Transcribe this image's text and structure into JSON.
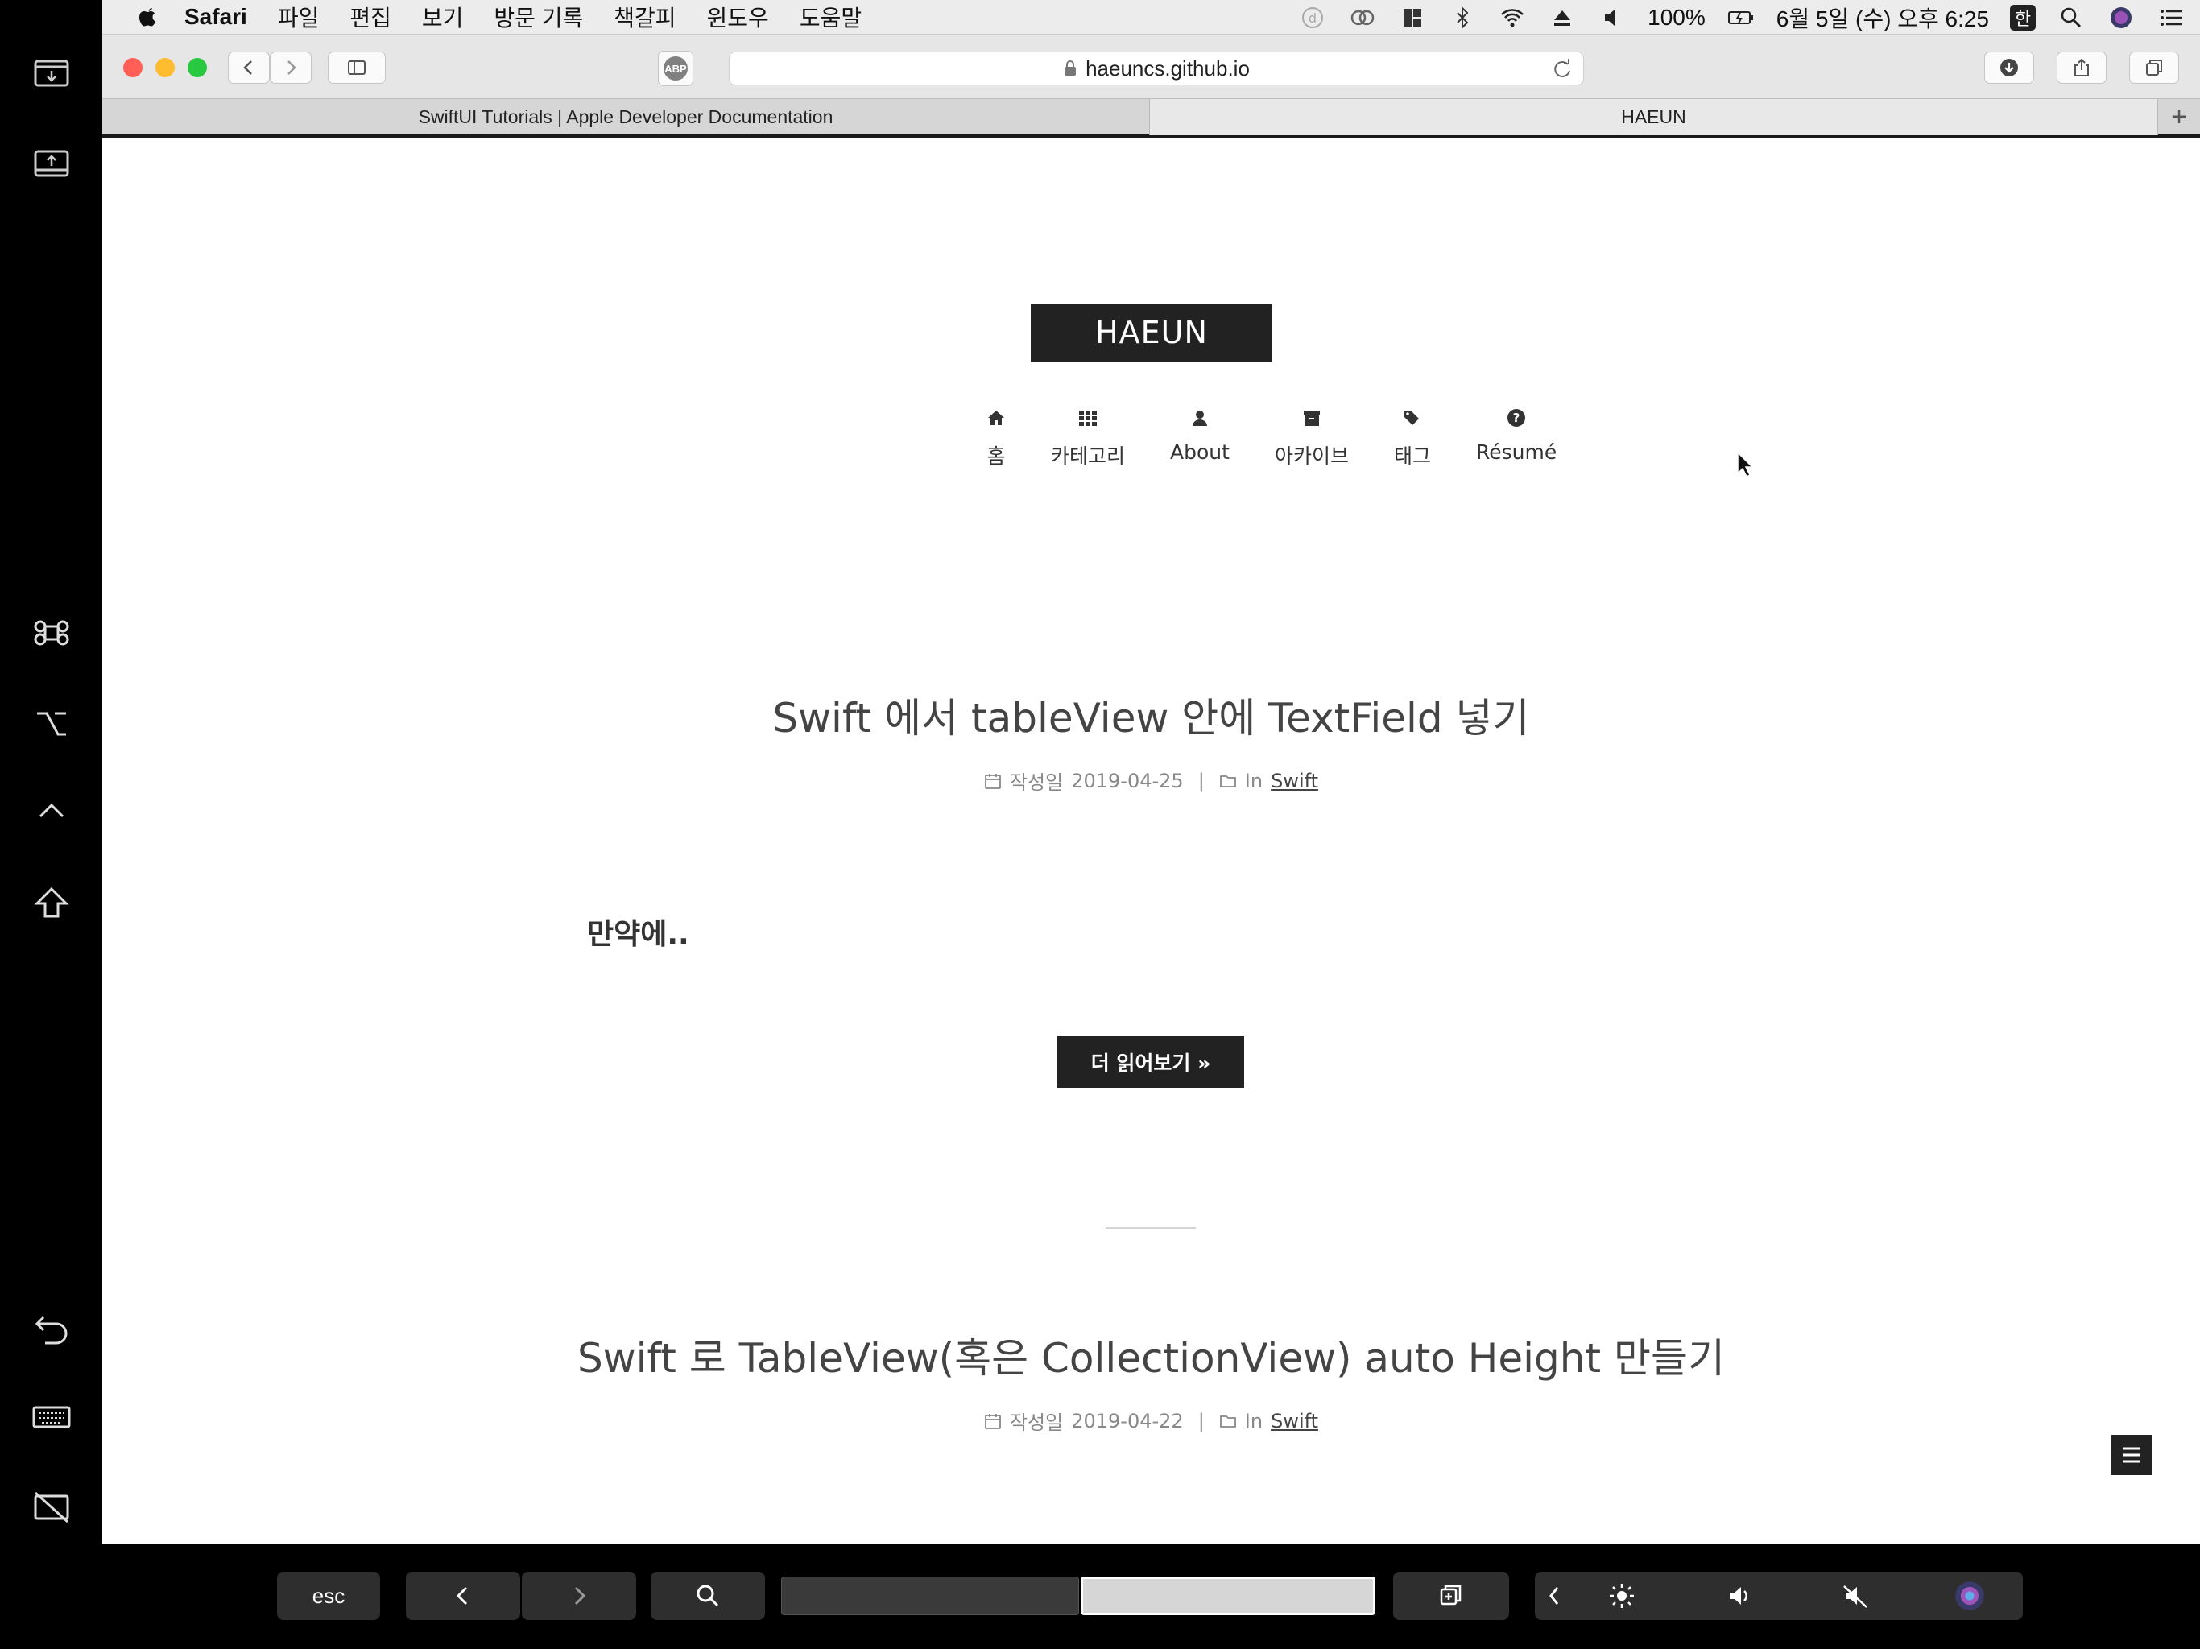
{
  "menubar": {
    "app_name": "Safari",
    "menus": [
      "파일",
      "편집",
      "보기",
      "방문 기록",
      "책갈피",
      "윈도우",
      "도움말"
    ],
    "battery": "100%",
    "datetime": "6월 5일 (수) 오후 6:25",
    "input_lang": "한"
  },
  "toolbar": {
    "url": "haeuncs.github.io",
    "abp_label": "ABP"
  },
  "tabs": [
    {
      "label": "SwiftUI Tutorials | Apple Developer Documentation",
      "active": false
    },
    {
      "label": "HAEUN",
      "active": true
    }
  ],
  "tab_add": "+",
  "site": {
    "brand": "HAEUN",
    "nav": [
      {
        "label": "홈",
        "icon": "home-icon"
      },
      {
        "label": "카테고리",
        "icon": "grid-icon"
      },
      {
        "label": "About",
        "icon": "user-icon"
      },
      {
        "label": "아카이브",
        "icon": "archive-icon"
      },
      {
        "label": "태그",
        "icon": "tags-icon"
      },
      {
        "label": "Résumé",
        "icon": "question-circle-icon"
      }
    ]
  },
  "posts": [
    {
      "title": "Swift 에서 tableView 안에 TextField 넣기",
      "date_label": "작성일",
      "date": "2019-04-25",
      "category_prefix": "In",
      "category": "Swift",
      "excerpt": "만약에..",
      "read_more": "더 읽어보기 »"
    },
    {
      "title": "Swift 로 TableView(혹은 CollectionView) auto Height 만들기",
      "date_label": "작성일",
      "date": "2019-04-22",
      "category_prefix": "In",
      "category": "Swift"
    }
  ],
  "touchbar": {
    "esc": "esc"
  }
}
